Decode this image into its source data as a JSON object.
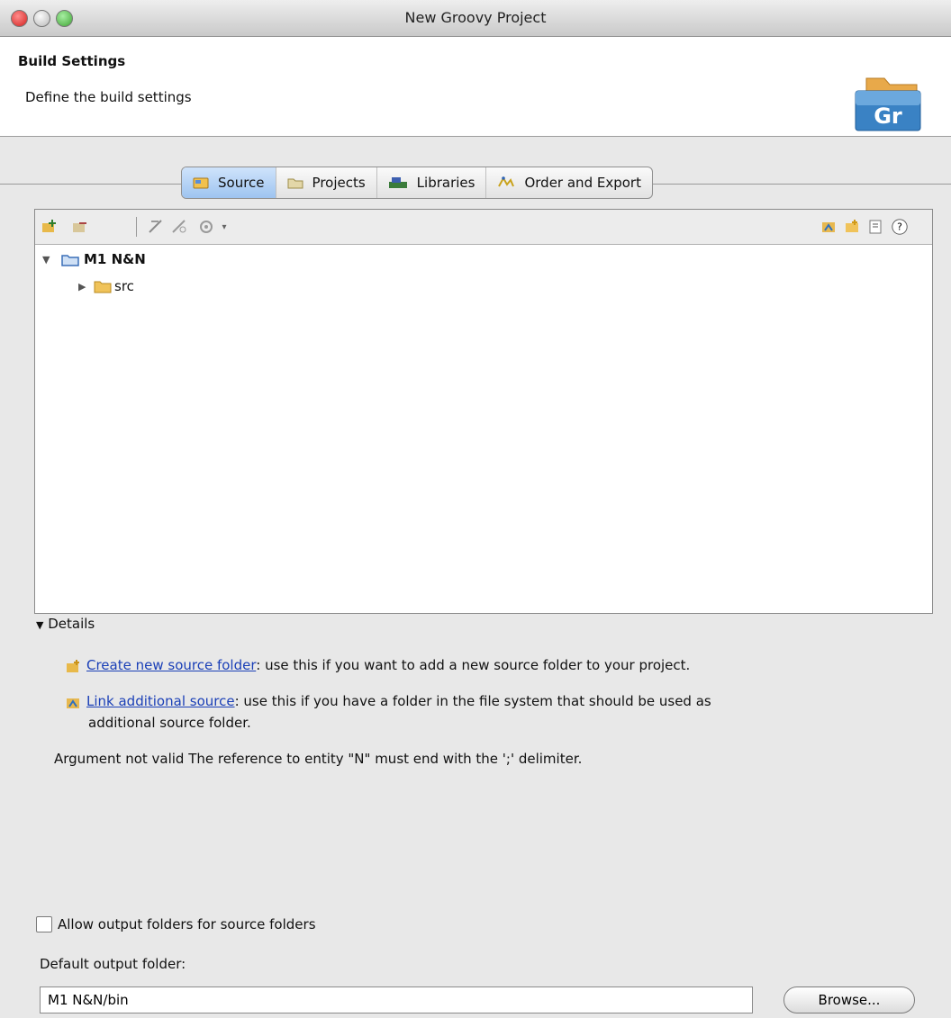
{
  "window": {
    "title": "New Groovy Project"
  },
  "banner": {
    "title": "Build Settings",
    "subtitle": "Define the build settings",
    "icon_text": "Gr"
  },
  "tabs": [
    {
      "label": "Source",
      "icon": "source-folder-icon",
      "active": true
    },
    {
      "label": "Projects",
      "icon": "projects-icon",
      "active": false
    },
    {
      "label": "Libraries",
      "icon": "libraries-icon",
      "active": false
    },
    {
      "label": "Order and Export",
      "icon": "order-export-icon",
      "active": false
    }
  ],
  "tree": {
    "project": "M1 N&N",
    "children": [
      {
        "label": "src"
      }
    ]
  },
  "details": {
    "heading": "Details",
    "create_link": "Create new source folder",
    "create_desc": ": use this if you want to add a new source folder to your project.",
    "link_link": "Link additional source",
    "link_desc_1": ": use this if you have a folder in the file system that should be used as",
    "link_desc_2": "additional source folder."
  },
  "error": "Argument not valid The reference to entity \"N\" must end with the ';' delimiter.",
  "output": {
    "allow_label": "Allow output folders for source folders",
    "allow_checked": false,
    "default_label": "Default output folder:",
    "default_value": "M1 N&N/bin",
    "browse_label": "Browse..."
  }
}
